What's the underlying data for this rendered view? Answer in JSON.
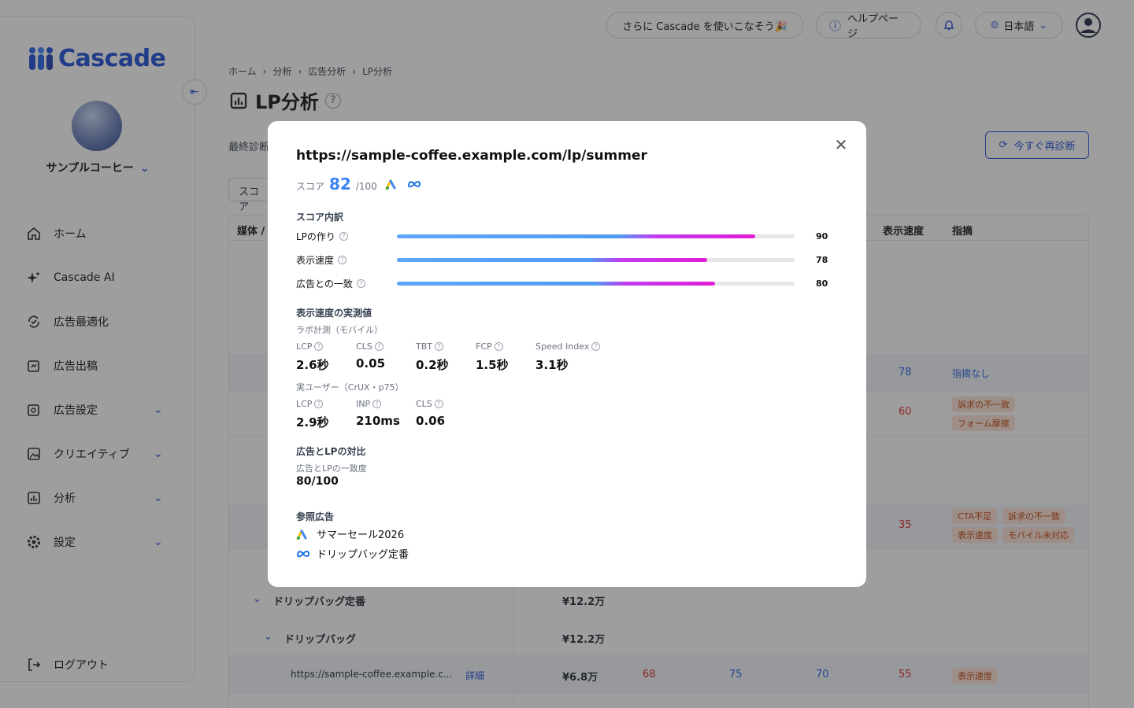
{
  "app": {
    "logo": "Cascade",
    "company": "サンプルコーヒー"
  },
  "topbar": {
    "promo": "さらに Cascade を使いこなそう🎉",
    "help": "ヘルプページ",
    "language": "日本語"
  },
  "sidebar": {
    "items": [
      {
        "label": "ホーム",
        "icon": "home-icon"
      },
      {
        "label": "Cascade AI",
        "icon": "sparkle-icon"
      },
      {
        "label": "広告最適化",
        "icon": "optimize-icon"
      },
      {
        "label": "広告出稿",
        "icon": "publish-icon"
      },
      {
        "label": "広告設定",
        "icon": "ad-settings-icon",
        "expandable": true
      },
      {
        "label": "クリエイティブ",
        "icon": "image-icon",
        "expandable": true
      },
      {
        "label": "分析",
        "icon": "analytics-icon",
        "expandable": true
      },
      {
        "label": "設定",
        "icon": "gear-icon",
        "expandable": true
      }
    ],
    "logout": "ログアウト"
  },
  "breadcrumb": [
    "ホーム",
    "分析",
    "広告分析",
    "LP分析"
  ],
  "page": {
    "title": "LP分析",
    "last_diagnosis": "最終診断",
    "rediagnose": "今すぐ再診断",
    "filter": "スコア"
  },
  "table": {
    "headers": {
      "media": "媒体 /",
      "speed": "表示速度",
      "issues": "指摘"
    },
    "rows": [
      {
        "speed": "78",
        "issues_text": "指摘なし"
      },
      {
        "speed": "60",
        "tags": [
          "訴求の不一致",
          "フォーム摩擦"
        ]
      },
      {
        "speed": "35",
        "tags": [
          "CTA不足",
          "訴求の不一致",
          "表示速度",
          "モバイル未対応"
        ]
      },
      {
        "name": "ドリップバッグ定番",
        "cost": "¥12.2万"
      },
      {
        "name": "ドリップバッグ",
        "cost": "¥12.2万"
      },
      {
        "url": "https://sample-coffee.example.c...",
        "detail": "詳細",
        "cost": "¥6.8万",
        "v1": "68",
        "v2": "75",
        "v3": "70",
        "speed": "55",
        "tags": [
          "表示速度"
        ]
      }
    ]
  },
  "modal": {
    "url": "https://sample-coffee.example.com/lp/summer",
    "score_label": "スコア",
    "score": "82",
    "score_max": "/100",
    "breakdown_title": "スコア内訳",
    "breakdown": [
      {
        "label": "LPの作り",
        "value": 90
      },
      {
        "label": "表示速度",
        "value": 78
      },
      {
        "label": "広告との一致",
        "value": 80
      }
    ],
    "speed_title": "表示速度の実測値",
    "lab_title": "ラボ計測（モバイル）",
    "lab": [
      {
        "label": "LCP",
        "value": "2.6秒"
      },
      {
        "label": "CLS",
        "value": "0.05"
      },
      {
        "label": "TBT",
        "value": "0.2秒"
      },
      {
        "label": "FCP",
        "value": "1.5秒"
      },
      {
        "label": "Speed Index",
        "value": "3.1秒"
      }
    ],
    "field_title": "実ユーザー（CrUX・p75）",
    "field": [
      {
        "label": "LCP",
        "value": "2.9秒"
      },
      {
        "label": "INP",
        "value": "210ms"
      },
      {
        "label": "CLS",
        "value": "0.06"
      }
    ],
    "compare_title": "広告とLPの対比",
    "match_label": "広告とLPの一致度",
    "match_value": "80/100",
    "ref_title": "参照広告",
    "refs": [
      {
        "label": "サマーセール2026",
        "icon": "google-ads-icon"
      },
      {
        "label": "ドリップバッグ定番",
        "icon": "meta-icon"
      }
    ]
  },
  "colors": {
    "brand": "#1d4ed8",
    "score": "#3b82f6",
    "bar_start": "#60a5fa",
    "bar_end": "#e11dd6"
  }
}
